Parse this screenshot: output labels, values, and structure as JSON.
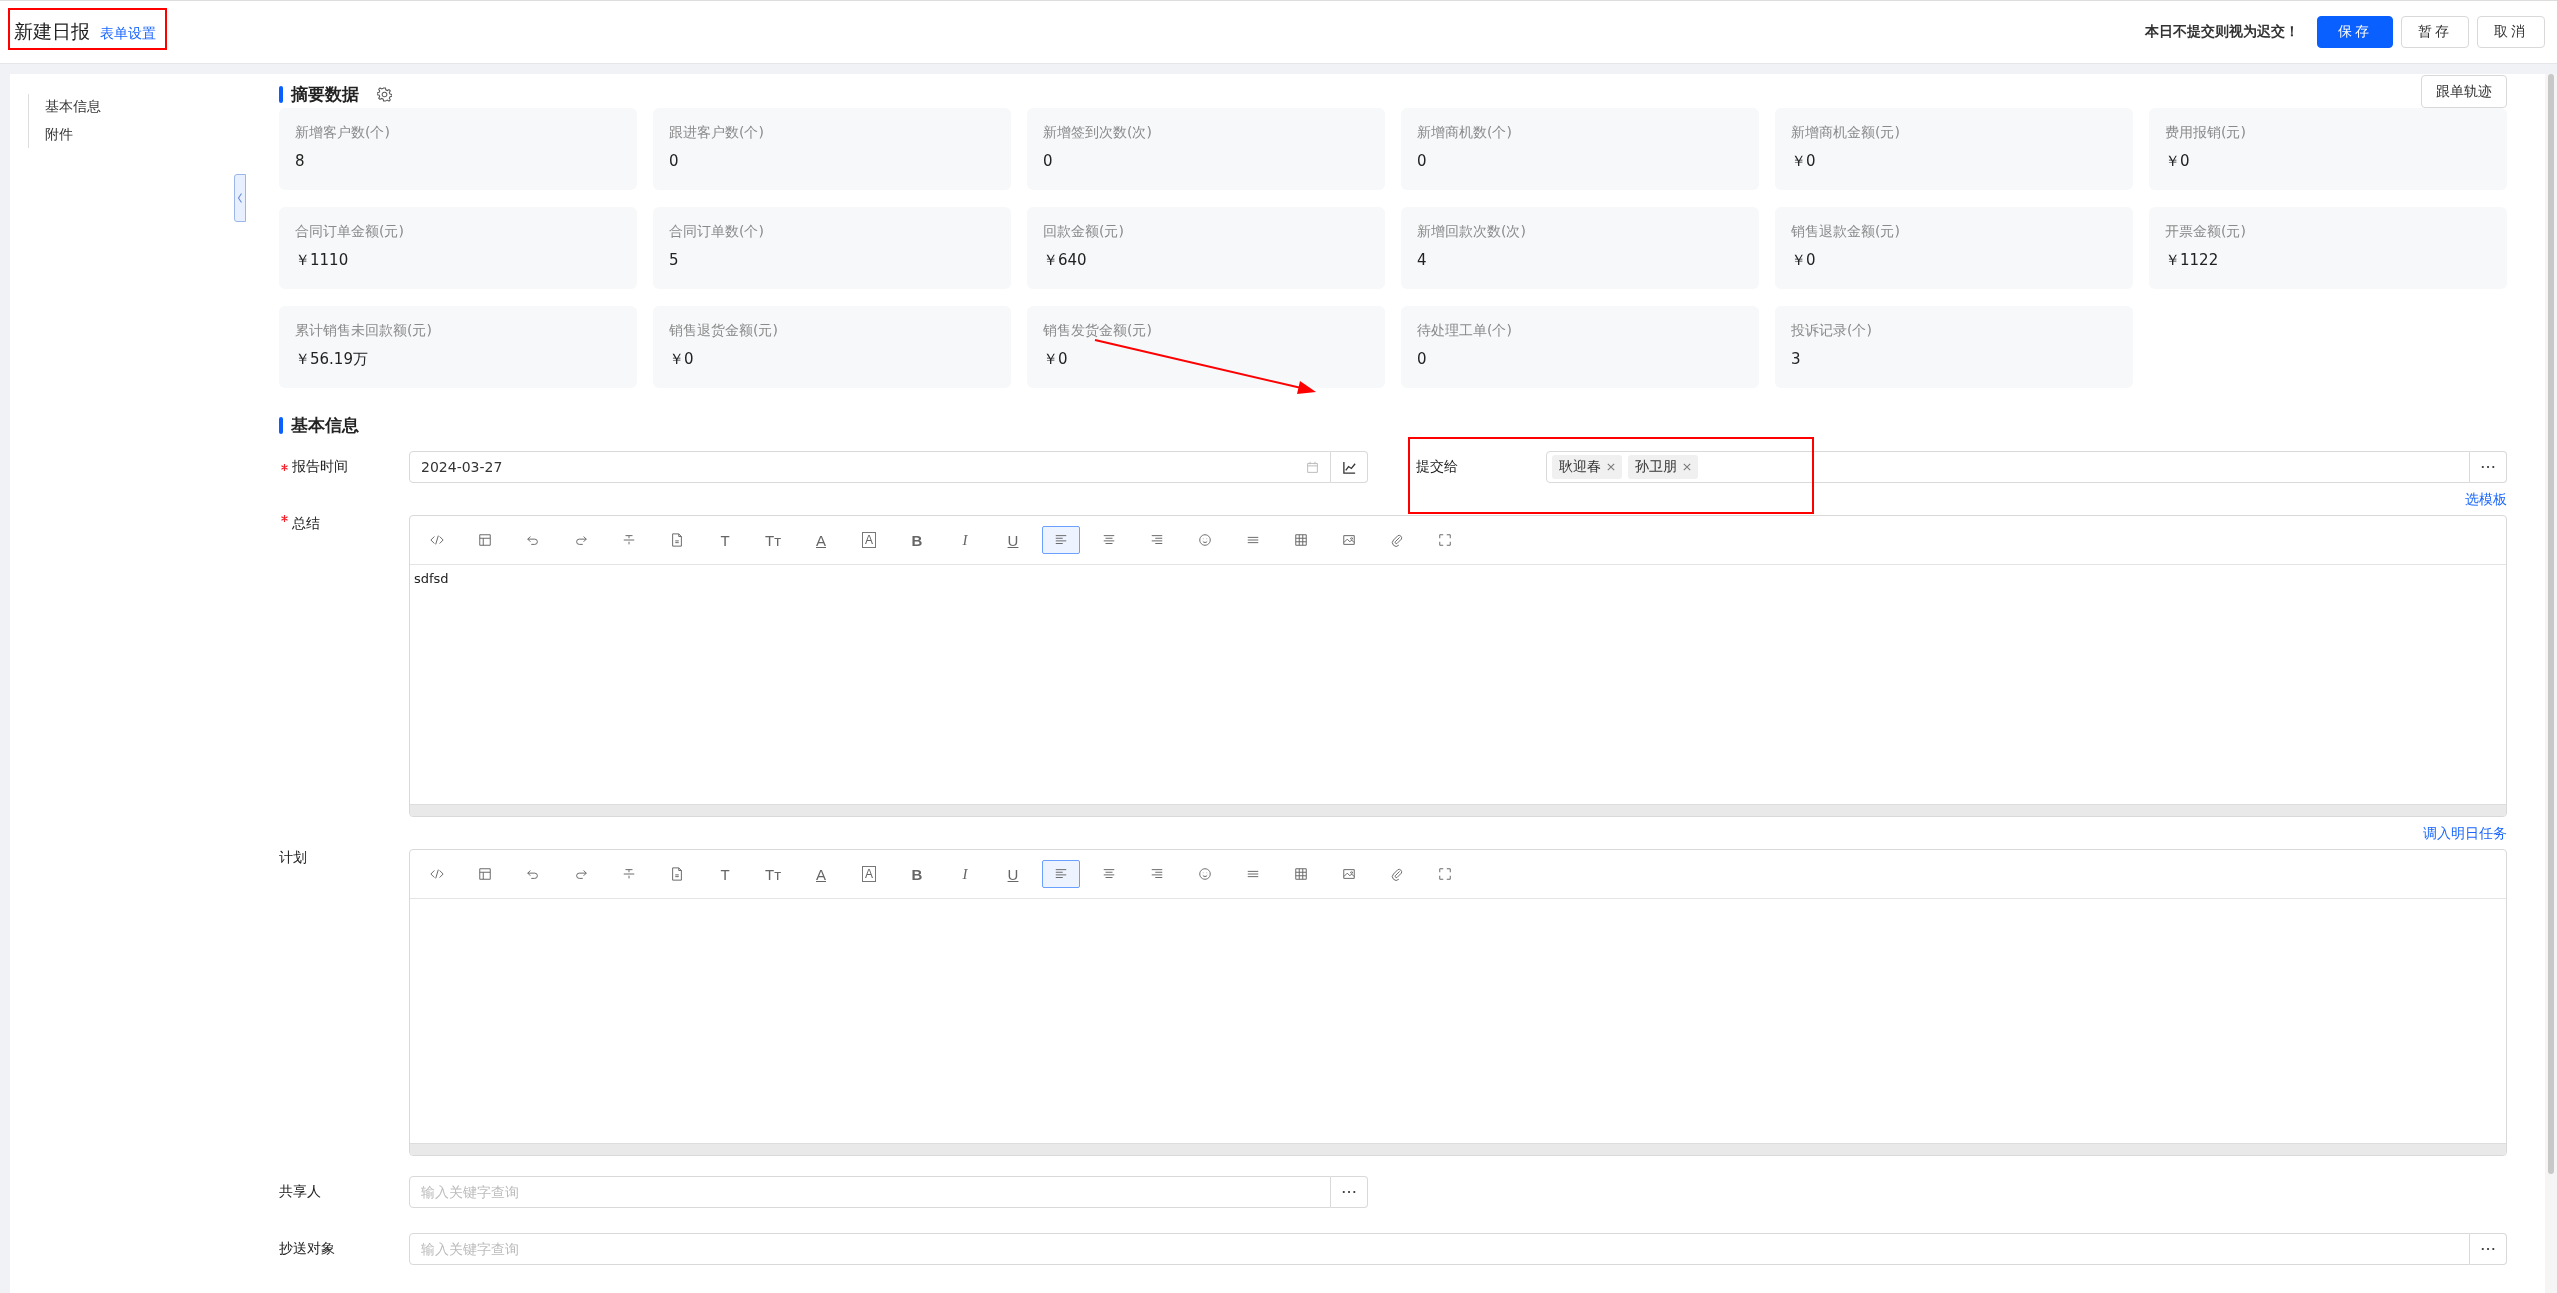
{
  "header": {
    "title": "新建日报",
    "settings_link": "表单设置",
    "notice": "本日不提交则视为迟交！",
    "buttons": [
      {
        "label": "保存",
        "kind": "primary"
      },
      {
        "label": "暂存",
        "kind": "default"
      },
      {
        "label": "取消",
        "kind": "default"
      }
    ]
  },
  "sidebar": {
    "items": [
      "基本信息",
      "附件"
    ]
  },
  "summary": {
    "title": "摘要数据",
    "track_button": "跟单轨迹",
    "cards": [
      {
        "label": "新增客户数(个)",
        "value": "8"
      },
      {
        "label": "跟进客户数(个)",
        "value": "0"
      },
      {
        "label": "新增签到次数(次)",
        "value": "0"
      },
      {
        "label": "新增商机数(个)",
        "value": "0"
      },
      {
        "label": "新增商机金额(元)",
        "value": "￥0"
      },
      {
        "label": "费用报销(元)",
        "value": "￥0"
      },
      {
        "label": "合同订单金额(元)",
        "value": "￥1110"
      },
      {
        "label": "合同订单数(个)",
        "value": "5"
      },
      {
        "label": "回款金额(元)",
        "value": "￥640"
      },
      {
        "label": "新增回款次数(次)",
        "value": "4"
      },
      {
        "label": "销售退款金额(元)",
        "value": "￥0"
      },
      {
        "label": "开票金额(元)",
        "value": "￥1122"
      },
      {
        "label": "累计销售未回款额(元)",
        "value": "￥56.19万"
      },
      {
        "label": "销售退货金额(元)",
        "value": "￥0"
      },
      {
        "label": "销售发货金额(元)",
        "value": "￥0"
      },
      {
        "label": "待处理工单(个)",
        "value": "0"
      },
      {
        "label": "投诉记录(个)",
        "value": "3"
      }
    ]
  },
  "basic": {
    "title": "基本信息",
    "report_time": {
      "label": "报告时间",
      "required": true,
      "value": "2024-03-27"
    },
    "submit_to": {
      "label": "提交给",
      "tags": [
        "耿迎春",
        "孙卫朋"
      ],
      "template_link": "选模板"
    },
    "editors": [
      {
        "label": "总结",
        "required": true,
        "content": "sdfsd",
        "link": "调入明日任务",
        "toolbar": [
          {
            "kind": "code",
            "selected": false
          },
          {
            "kind": "template",
            "selected": false
          },
          {
            "kind": "undo",
            "selected": false
          },
          {
            "kind": "redo",
            "selected": false
          },
          {
            "kind": "strike",
            "selected": false
          },
          {
            "kind": "file",
            "selected": false
          },
          {
            "kind": "letter",
            "glyph": "T",
            "selected": false
          },
          {
            "kind": "letter",
            "glyph": "Tт",
            "selected": false
          },
          {
            "kind": "underlined",
            "glyph": "A",
            "selected": false
          },
          {
            "kind": "boxed",
            "glyph": "A",
            "selected": false
          },
          {
            "kind": "bold",
            "glyph": "B",
            "selected": false
          },
          {
            "kind": "italic",
            "glyph": "I",
            "selected": false
          },
          {
            "kind": "underlined",
            "glyph": "U",
            "selected": false
          },
          {
            "kind": "align-left",
            "selected": true
          },
          {
            "kind": "align-center",
            "selected": false
          },
          {
            "kind": "align-right",
            "selected": false
          },
          {
            "kind": "emoji",
            "selected": false
          },
          {
            "kind": "rule",
            "selected": false
          },
          {
            "kind": "table",
            "selected": false
          },
          {
            "kind": "image",
            "selected": false
          },
          {
            "kind": "attach",
            "selected": false
          },
          {
            "kind": "fullscreen",
            "selected": false
          }
        ]
      },
      {
        "label": "计划",
        "required": false,
        "toolbar": [
          {
            "kind": "code",
            "selected": false
          },
          {
            "kind": "template",
            "selected": false
          },
          {
            "kind": "undo",
            "selected": false
          },
          {
            "kind": "redo",
            "selected": false
          },
          {
            "kind": "strike",
            "selected": false
          },
          {
            "kind": "file",
            "selected": false
          },
          {
            "kind": "letter",
            "glyph": "T",
            "selected": false
          },
          {
            "kind": "letter",
            "glyph": "Tт",
            "selected": false
          },
          {
            "kind": "underlined",
            "glyph": "A",
            "selected": false
          },
          {
            "kind": "boxed",
            "glyph": "A",
            "selected": false
          },
          {
            "kind": "bold",
            "glyph": "B",
            "selected": false
          },
          {
            "kind": "italic",
            "glyph": "I",
            "selected": false
          },
          {
            "kind": "underlined",
            "glyph": "U",
            "selected": false
          },
          {
            "kind": "align-left",
            "selected": true
          },
          {
            "kind": "align-center",
            "selected": false
          },
          {
            "kind": "align-right",
            "selected": false
          },
          {
            "kind": "emoji",
            "selected": false
          },
          {
            "kind": "rule",
            "selected": false
          },
          {
            "kind": "table",
            "selected": false
          },
          {
            "kind": "image",
            "selected": false
          },
          {
            "kind": "attach",
            "selected": false
          },
          {
            "kind": "fullscreen",
            "selected": false
          }
        ]
      }
    ],
    "sharers": {
      "label": "共享人",
      "placeholder": "输入关键字查询"
    },
    "cc": {
      "label": "抄送对象",
      "placeholder": "输入关键字查询"
    }
  }
}
